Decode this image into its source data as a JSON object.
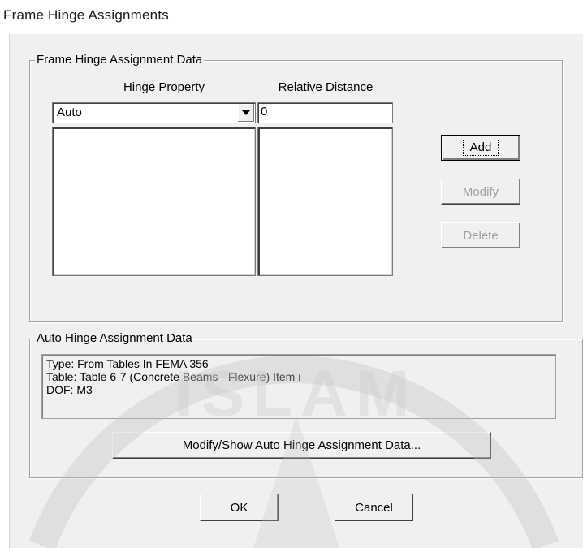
{
  "window": {
    "title": "Frame Hinge Assignments"
  },
  "frame_group": {
    "legend": "Frame Hinge Assignment Data",
    "hinge_property_header": "Hinge Property",
    "relative_distance_header": "Relative Distance",
    "hinge_property_value": "Auto",
    "relative_distance_value": "0",
    "add_label": "Add",
    "modify_label": "Modify",
    "delete_label": "Delete"
  },
  "auto_group": {
    "legend": "Auto Hinge Assignment Data",
    "lines": [
      "Type:  From Tables In FEMA 356",
      "Table:  Table 6-7 (Concrete Beams - Flexure) Item i",
      "DOF:  M3"
    ],
    "modify_show_label": "Modify/Show Auto Hinge Assignment Data..."
  },
  "footer": {
    "ok_label": "OK",
    "cancel_label": "Cancel"
  },
  "watermark": {
    "text": "ISLAM"
  },
  "colors": {
    "dialog_bg": "#f0f0f0",
    "disabled_text": "#a0a0a0"
  }
}
